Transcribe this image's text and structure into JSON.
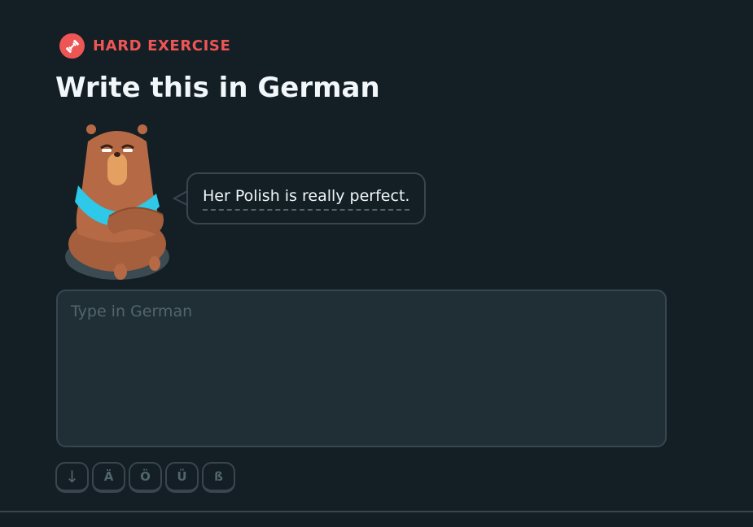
{
  "colors": {
    "background": "#131f24",
    "accent_red": "#ee5555",
    "border": "#37464f",
    "input_bg": "#202f36",
    "muted_text": "#52656d",
    "text": "#f1f7fb"
  },
  "badge": {
    "icon": "dumbbell-icon",
    "label": "HARD EXERCISE"
  },
  "title": "Write this in German",
  "character": {
    "icon": "bear-character"
  },
  "prompt": {
    "sentence": "Her Polish is really perfect."
  },
  "answer": {
    "value": "",
    "placeholder": "Type in German"
  },
  "special_keys": [
    {
      "label": "↓",
      "icon": "arrow-down-icon"
    },
    {
      "label": "Ä"
    },
    {
      "label": "Ö"
    },
    {
      "label": "Ü"
    },
    {
      "label": "ß"
    }
  ]
}
